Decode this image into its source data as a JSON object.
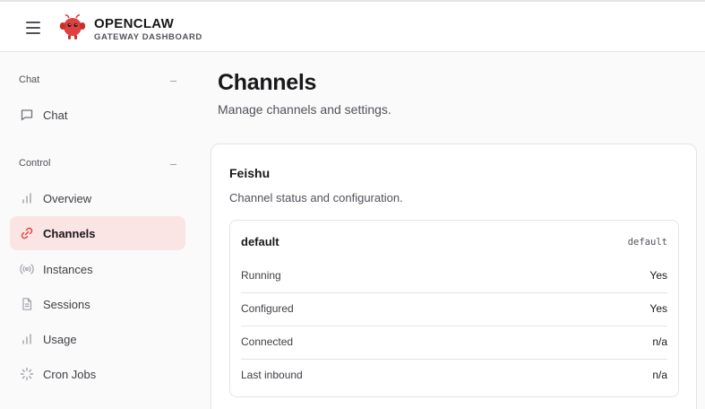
{
  "header": {
    "brand_name": "OPENCLAW",
    "brand_subtitle": "GATEWAY DASHBOARD",
    "accent_color": "#e0403d"
  },
  "sidebar": {
    "sections": [
      {
        "title": "Chat",
        "items": [
          {
            "label": "Chat",
            "icon": "message-square-icon",
            "active": false
          }
        ]
      },
      {
        "title": "Control",
        "items": [
          {
            "label": "Overview",
            "icon": "bar-chart-icon",
            "active": false
          },
          {
            "label": "Channels",
            "icon": "link-icon",
            "active": true
          },
          {
            "label": "Instances",
            "icon": "radio-icon",
            "active": false
          },
          {
            "label": "Sessions",
            "icon": "file-text-icon",
            "active": false
          },
          {
            "label": "Usage",
            "icon": "bar-chart-icon",
            "active": false
          },
          {
            "label": "Cron Jobs",
            "icon": "loader-icon",
            "active": false
          }
        ]
      }
    ]
  },
  "main": {
    "title": "Channels",
    "subtitle": "Manage channels and settings.",
    "card": {
      "title": "Feishu",
      "subtitle": "Channel status and configuration.",
      "account": {
        "name": "default",
        "tag": "default",
        "rows": [
          {
            "label": "Running",
            "value": "Yes"
          },
          {
            "label": "Configured",
            "value": "Yes"
          },
          {
            "label": "Connected",
            "value": "n/a"
          },
          {
            "label": "Last inbound",
            "value": "n/a"
          }
        ]
      }
    }
  }
}
